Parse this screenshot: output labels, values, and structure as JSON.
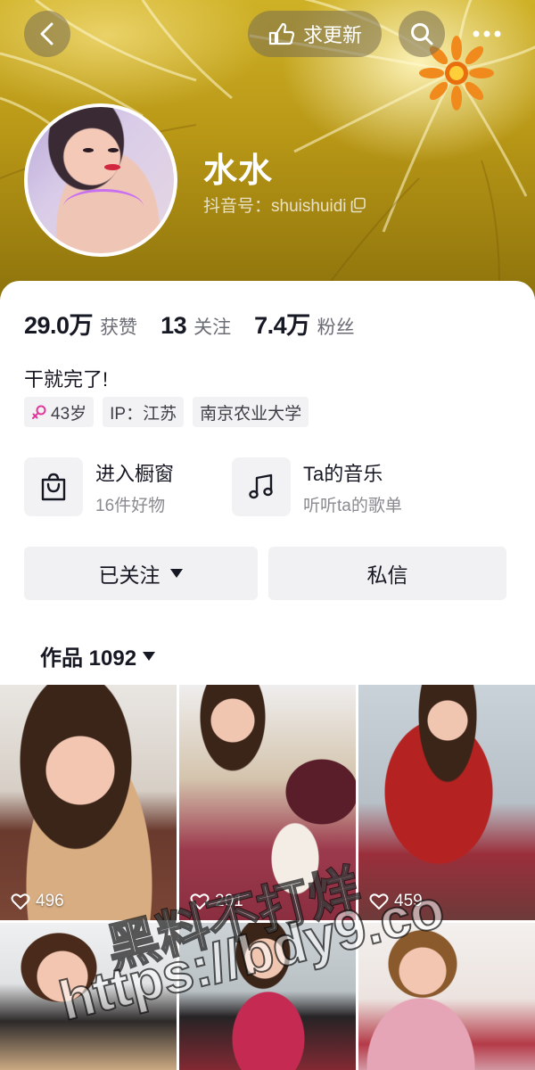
{
  "header": {
    "update_label": "求更新",
    "back_icon": "chevron-left-icon",
    "search_icon": "search-icon",
    "more_icon": "more-dots-icon"
  },
  "profile": {
    "name": "水水",
    "douyin_id": "抖音号：shuishuidi",
    "stats": [
      {
        "value": "29.0万",
        "label": "获赞"
      },
      {
        "value": "13",
        "label": "关注"
      },
      {
        "value": "7.4万",
        "label": "粉丝"
      }
    ],
    "bio": "干就完了!",
    "tags": {
      "age": "43岁",
      "ip": "IP：江苏",
      "school": "南京农业大学"
    }
  },
  "features": {
    "shop": {
      "title": "进入橱窗",
      "subtitle": "16件好物"
    },
    "music": {
      "title": "Ta的音乐",
      "subtitle": "听听ta的歌单"
    }
  },
  "actions": {
    "follow_label": "已关注",
    "message_label": "私信"
  },
  "works": {
    "label": "作品 1092",
    "videos": [
      {
        "likes": "496"
      },
      {
        "likes": "201"
      },
      {
        "likes": "459"
      },
      {
        "likes": ""
      },
      {
        "likes": ""
      },
      {
        "likes": ""
      }
    ]
  },
  "watermark": {
    "line1": "黑料不打烊",
    "line2": "https://bdy9.co"
  },
  "colors": {
    "banner": "#b89716",
    "text_primary": "#161823",
    "text_secondary": "#6b6d75",
    "chip_bg": "#f2f2f4",
    "female_icon": "#e0389a"
  }
}
